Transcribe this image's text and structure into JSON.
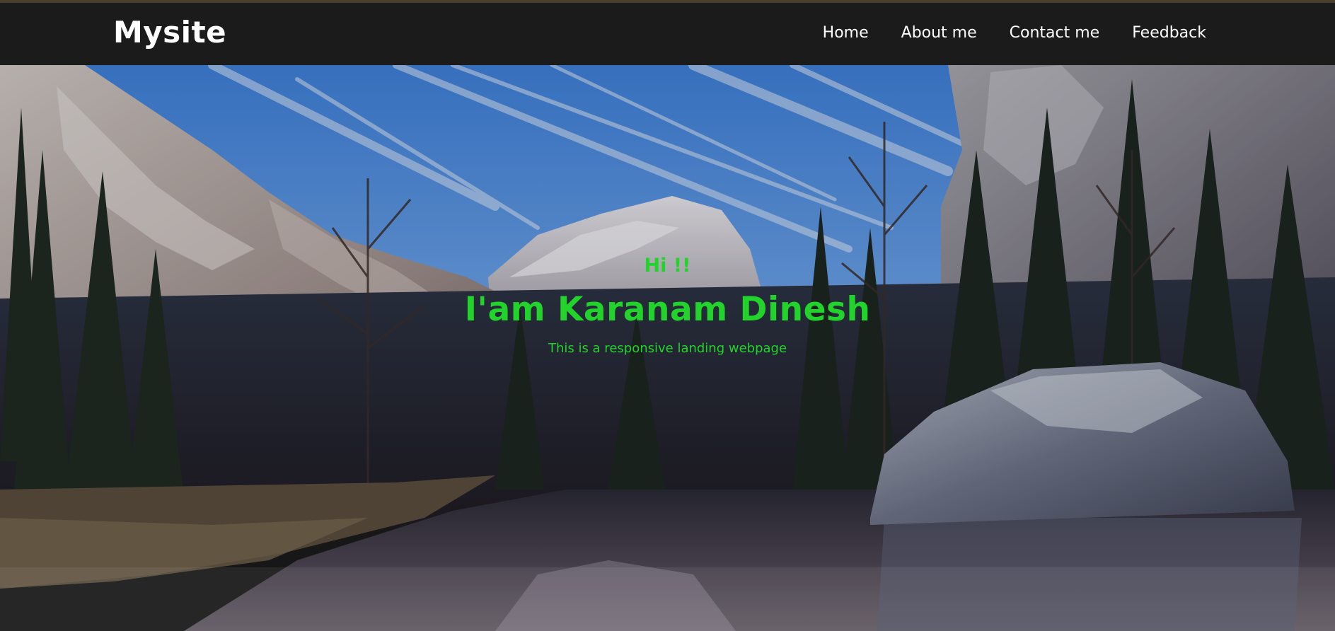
{
  "navbar": {
    "brand": "Mysite",
    "links": [
      {
        "label": "Home"
      },
      {
        "label": "About me"
      },
      {
        "label": "Contact me"
      },
      {
        "label": "Feedback"
      }
    ]
  },
  "hero": {
    "greeting": "Hi !!",
    "name": "I'am Karanam Dinesh",
    "tagline": "This is a responsive landing webpage"
  },
  "colors": {
    "navbar_bg": "#1b1b1b",
    "nav_text": "#ffffff",
    "hero_text": "#22d32b"
  }
}
